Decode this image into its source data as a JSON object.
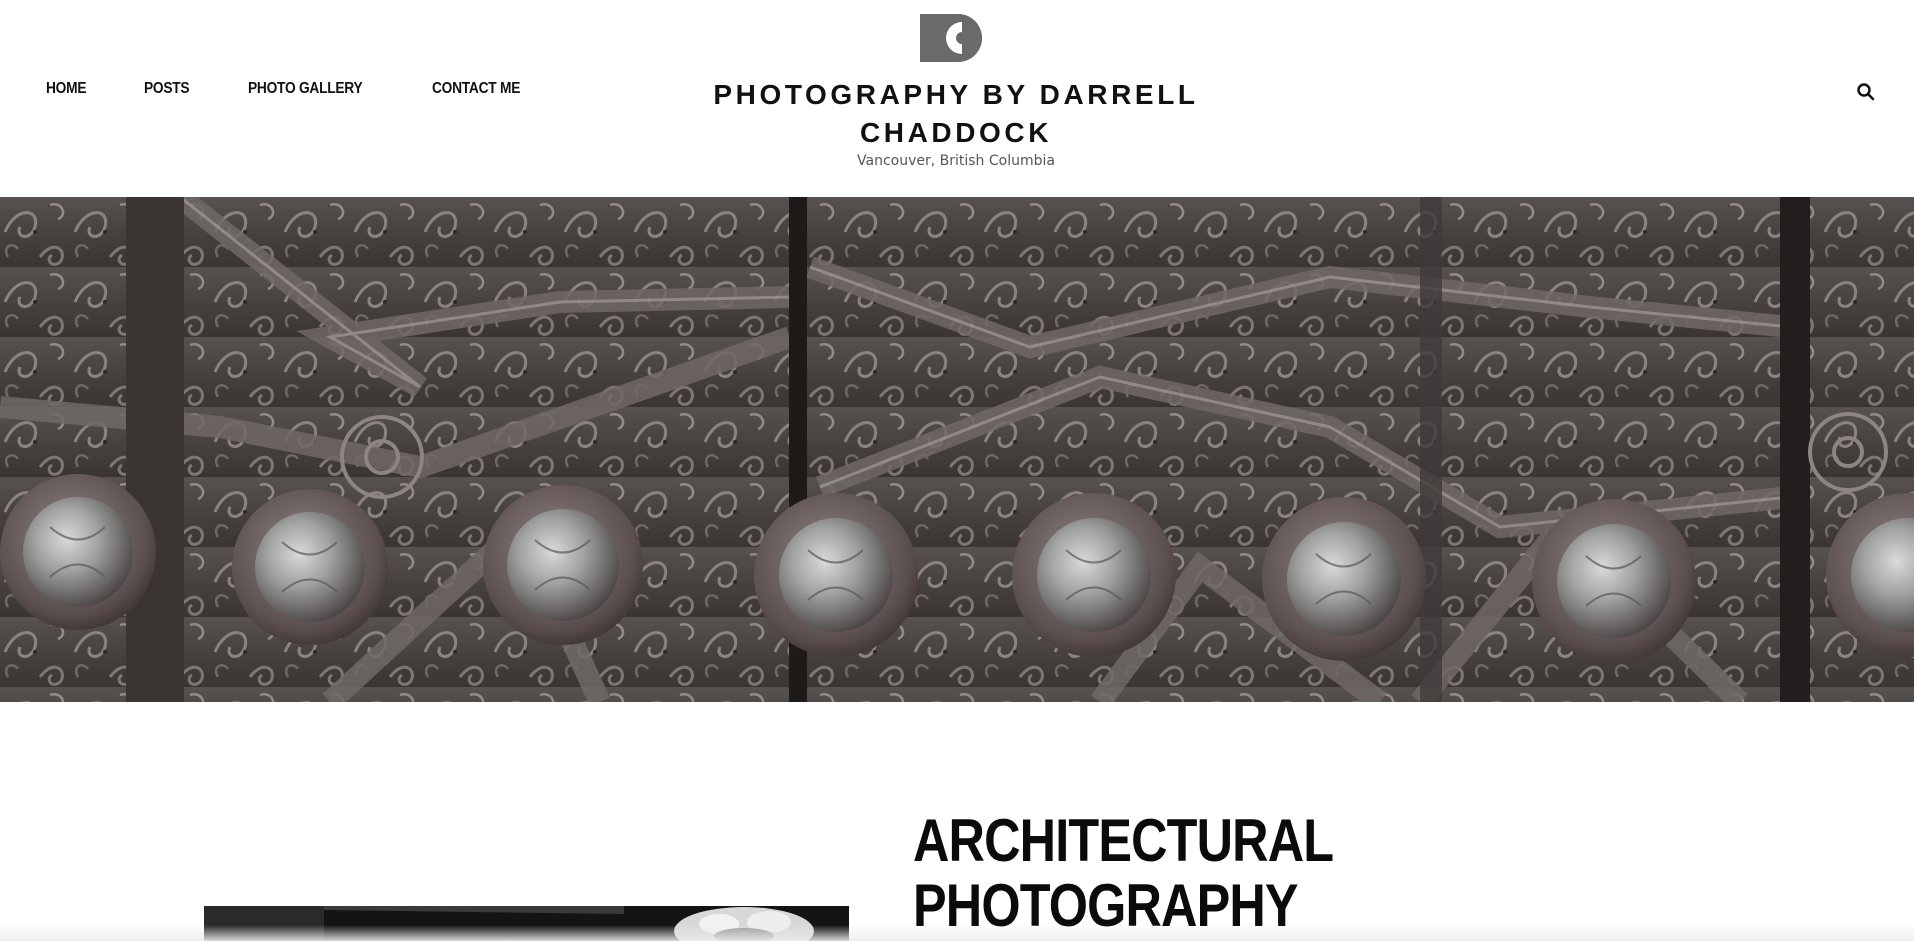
{
  "header": {
    "nav": [
      {
        "label": "HOME"
      },
      {
        "label": "POSTS"
      },
      {
        "label": "PHOTO GALLERY"
      },
      {
        "label": "CONTACT ME"
      }
    ],
    "logo_icon": "camera-lens-logo-icon",
    "site_title": "PHOTOGRAPHY BY DARRELL CHADDOCK",
    "tagline": "Vancouver, British Columbia",
    "search_icon": "search-icon"
  },
  "hero": {
    "image": "carved-wooden-door-with-metal-studs"
  },
  "section": {
    "title_line1": "ARCHITECTURAL",
    "title_line2": "PHOTOGRAPHY",
    "image": "black-and-white-architectural-photo"
  },
  "colors": {
    "text": "#111111",
    "tagline": "#555555",
    "logo": "#6a6a6a",
    "hero_wood": "#4a4442"
  }
}
